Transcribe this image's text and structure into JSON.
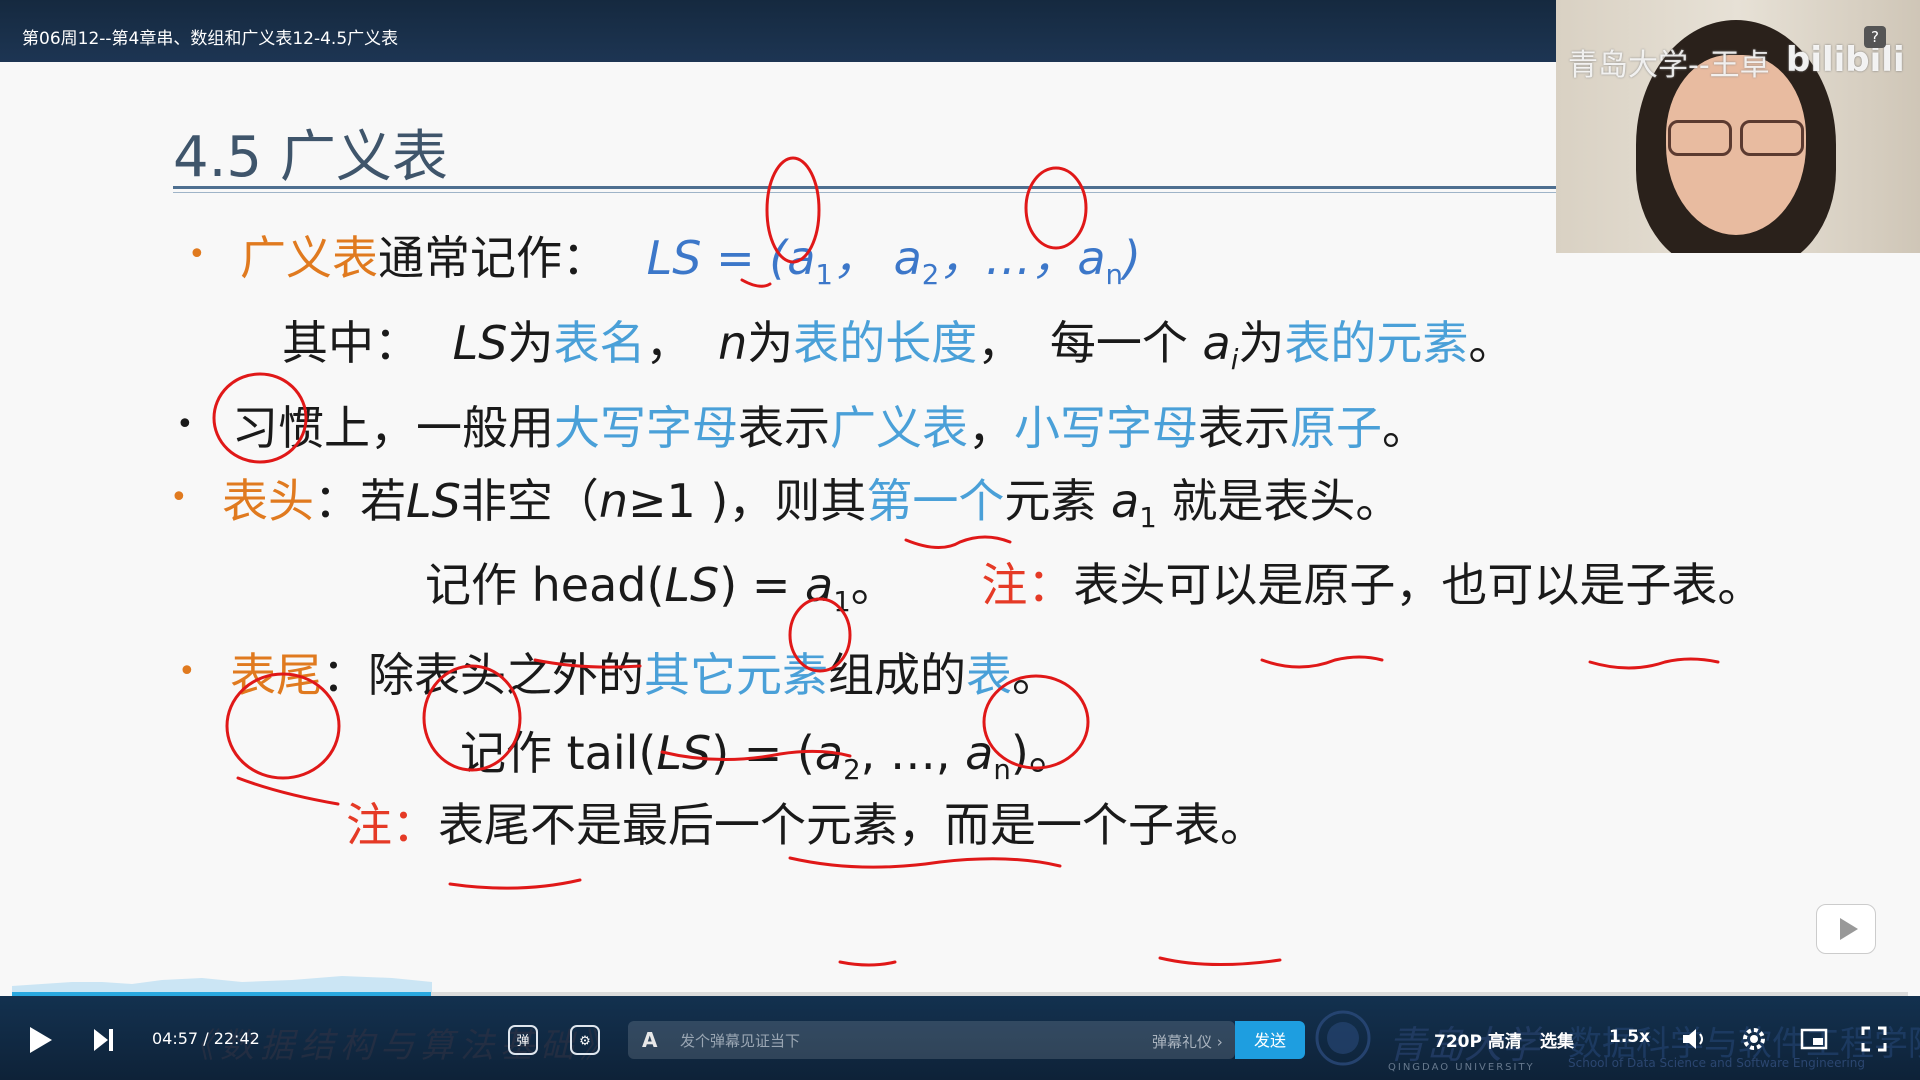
{
  "video_title": "第06周12--第4章串、数组和广义表12-4.5广义表",
  "webcam": {
    "watermark": "青岛大学--王卓",
    "brand": "bilibili"
  },
  "help_label": "?",
  "slide": {
    "heading": "4.5 广义表",
    "line1": {
      "term": "广义表",
      "text": "通常记作：",
      "formula_prefix": "LS = (",
      "a1": "a",
      "a1_sub": "1",
      "sep": "， a",
      "a2_sub": "2",
      "dots": "，…，",
      "an": "a",
      "an_sub": "n",
      "close": ")"
    },
    "line2": {
      "prefix": "其中：",
      "ls": "LS",
      "t1": "为",
      "b1": "表名",
      "c1": "，",
      "n": "n",
      "t2": "为",
      "b2": "表的长度",
      "c2": "，",
      "t3": "每一个",
      "ai": "a",
      "ai_sub": "i",
      "t4": "为",
      "b3": "表的元素",
      "end": "。"
    },
    "line3": {
      "t1": "习惯上，一般用",
      "b1": "大写字母",
      "t2": "表示",
      "b2": "广义表",
      "t3": "，",
      "b3": "小写字母",
      "t4": "表示",
      "b4": "原子",
      "end": "。"
    },
    "line4": {
      "term": "表头",
      "t1": "：若",
      "ls": "LS",
      "t2": "非空（",
      "n": "n",
      "t3": "≥1 )，则其",
      "b1": "第一个",
      "t4": "元素",
      "a": "a",
      "a_sub": "1",
      "t5": "就是表头。"
    },
    "line5": {
      "t1": "记作 head(",
      "ls": "LS",
      "t2": ") = ",
      "a": "a",
      "a_sub": "1",
      "end": "。",
      "note": "注：",
      "t3": "表头可以是原子，也可以是子表。"
    },
    "line6": {
      "term": "表尾",
      "t1": "：除表头之外的",
      "b1": "其它元素",
      "t2": "组成的",
      "b2": "表",
      "end": "。"
    },
    "line7": {
      "t1": "记作  tail(",
      "ls": "LS",
      "t2": ") = (",
      "a2": "a",
      "a2_sub": "2",
      "t3": ", …, ",
      "an": "a",
      "an_sub": "n",
      "end": ")。"
    },
    "line8": {
      "note": "注：",
      "t1": "表尾不是最后一个元素，而是一个子表。"
    }
  },
  "player": {
    "progress": 0.221,
    "current_time": "04:57",
    "separator": "/",
    "duration": "22:42",
    "slogan": "《数据结构与算法基础》",
    "danmaku_placeholder": "发个弹幕见证当下",
    "danmaku_gift": "弹幕礼仪 ›",
    "send_label": "发送",
    "university_name": "青岛大学",
    "university_name_en": "QINGDAO UNIVERSITY",
    "school_cn": "数据科学与软件工程学院",
    "school_en": "School of Data Science and Software Engineering",
    "quality": "720P 高清",
    "episodes": "选集",
    "speed": "1.5x"
  },
  "colors": {
    "accent_orange": "#e07a1f",
    "accent_blue": "#4aa0d8",
    "note_red": "#e53a26",
    "player_blue": "#1e9ee0"
  }
}
